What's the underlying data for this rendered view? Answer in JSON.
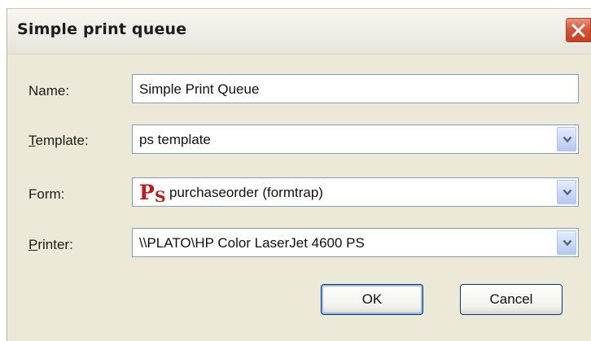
{
  "window": {
    "title": "Simple print queue",
    "close_icon": "close-icon"
  },
  "form": {
    "name": {
      "label": "Name:",
      "value": "Simple Print Queue"
    },
    "template": {
      "label_accel": "T",
      "label_rest": "emplate:",
      "value": "ps template"
    },
    "form": {
      "label": "Form:",
      "icon_text_p": "P",
      "icon_text_s": "S",
      "icon": "ps-form-icon",
      "value": "purchaseorder (formtrap)"
    },
    "printer": {
      "label_accel": "P",
      "label_rest": "rinter:",
      "value": "\\\\PLATO\\HP Color LaserJet 4600 PS"
    }
  },
  "buttons": {
    "ok": "OK",
    "cancel": "Cancel"
  },
  "colors": {
    "dialog_bg": "#ece9d8",
    "close_button": "#d6573b",
    "field_border": "#7f9db9",
    "button_border": "#003c74",
    "ps_icon": "#c4171c"
  }
}
